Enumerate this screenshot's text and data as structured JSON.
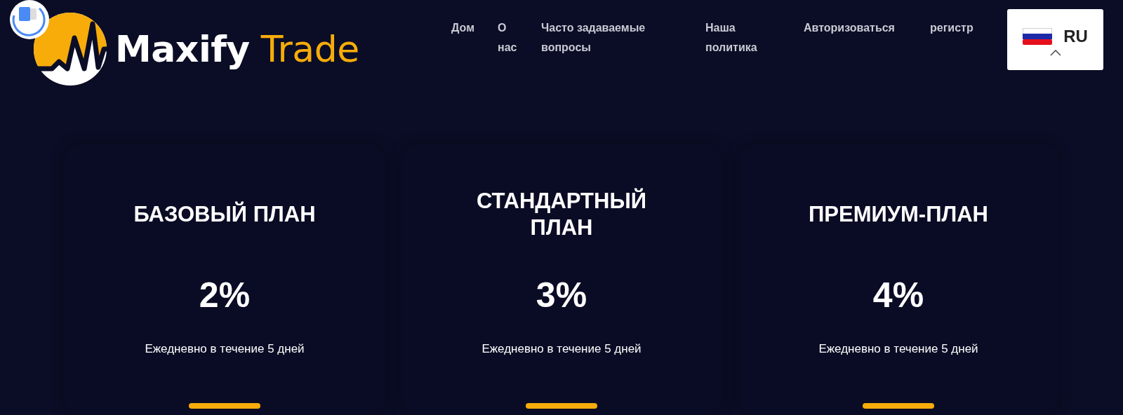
{
  "logo": {
    "brand": "Maxify",
    "accent": "Trade"
  },
  "nav": [
    {
      "label": "Дом"
    },
    {
      "label": "О нас"
    },
    {
      "label": "Часто задаваемые вопросы"
    },
    {
      "label": "Наша политика"
    },
    {
      "label": "Авторизоваться"
    },
    {
      "label": "регистр"
    }
  ],
  "language": {
    "code": "RU"
  },
  "plans": [
    {
      "title": "БАЗОВЫЙ ПЛАН",
      "rate": "2%",
      "note": "Ежедневно в течение 5 дней"
    },
    {
      "title": "СТАНДАРТНЫЙ ПЛАН",
      "rate": "3%",
      "note": "Ежедневно в течение 5 дней"
    },
    {
      "title": "ПРЕМИУМ-ПЛАН",
      "rate": "4%",
      "note": "Ежедневно в течение 5 дней"
    }
  ]
}
